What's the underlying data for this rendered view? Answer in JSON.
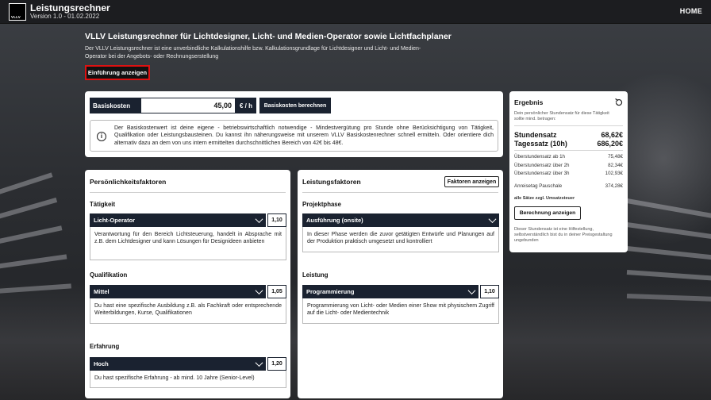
{
  "app": {
    "title": "Leistungsrechner",
    "version": "Version 1.0 - 01.02.2022",
    "logo_text": "VLLV",
    "nav_home": "HOME"
  },
  "intro": {
    "heading": "VLLV Leistungsrechner für Lichtdesigner, Licht- und Medien-Operator sowie Lichtfachplaner",
    "text": "Der VLLV Leistungsrechner ist eine unverbindliche Kalkulationshilfe bzw. Kalkulationsgrundlage für Lichtdesigner und Licht- und Medien-Operator bei der Angebots- oder Rechnungserstellung",
    "button": "Einführung anzeigen"
  },
  "base": {
    "label": "Basiskosten",
    "value": "45,00",
    "unit": "€ / h",
    "calc_button": "Basiskosten berechnen",
    "info": "Der Basiskostenwert ist deine eigene - betriebswirtschaftlich notwendige - Mindestvergütung pro Stunde ohne Berücksichtigung von Tätigkeit, Qualifikation oder Leistungsbausteinen. Du kannst ihn näherungsweise mit unserem VLLV Basiskostenrechner schnell ermitteln. Oder orientiere dich alternativ dazu an dem von uns intern ermittelten durchschnittlichen Bereich von 42€ bis 48€."
  },
  "result": {
    "title": "Ergebnis",
    "intro": "Dein persönlicher Stundensatz für diese Tätigkeit sollte mind. betragen:",
    "hourly_label": "Stundensatz",
    "hourly_value": "68,62€",
    "daily_label": "Tagessatz (10h)",
    "daily_value": "686,20€",
    "overtime": [
      {
        "label": "Überstundensatz ab 1h",
        "value": "75,48€"
      },
      {
        "label": "Überstundensatz über 2h",
        "value": "82,34€"
      },
      {
        "label": "Überstundensatz über 3h",
        "value": "102,93€"
      }
    ],
    "travel_label": "Anreisetag Pauschale",
    "travel_value": "374,28€",
    "tax_note": "alle Sätze zzgl. Umsatzsteuer",
    "button": "Berechnung anzeigen",
    "footnote": "Dieser Stundensatz ist eine Hilfestellung, selbstverständlich bist du in deiner Preisgestaltung ungebunden"
  },
  "personal": {
    "title": "Persönlichkeitsfaktoren",
    "sections": [
      {
        "label": "Tätigkeit",
        "selected": "Licht-Operator",
        "factor": "1,10",
        "description": "Verantwortung für den Bereich Lichtsteuerung, handelt in Absprache mit z.B. dem Lichtdesigner und kann Lösungen für Designideen anbieten"
      },
      {
        "label": "Qualifikation",
        "selected": "Mittel",
        "factor": "1,05",
        "description": "Du hast eine spezifische Ausbildung z.B. als Fachkraft oder entsprechende Weiterbildungen, Kurse, Qualifikationen"
      },
      {
        "label": "Erfahrung",
        "selected": "Hoch",
        "factor": "1,20",
        "description": "Du hast spezifische Erfahrung - ab mind. 10 Jahre (Senior-Level)"
      }
    ]
  },
  "service": {
    "title": "Leistungsfaktoren",
    "button": "Faktoren anzeigen",
    "sections": [
      {
        "label": "Projektphase",
        "selected": "Ausführung (onsite)",
        "description": "In dieser Phase werden die zuvor getätigten Entwürfe und Planungen auf der Produktion praktisch umgesetzt und kontrolliert"
      },
      {
        "label": "Leistung",
        "selected": "Programmierung",
        "factor": "1,10",
        "description": "Programmierung von Licht- oder Medien einer Show mit physischem Zugriff auf die Licht- oder Medientechnik"
      }
    ]
  }
}
